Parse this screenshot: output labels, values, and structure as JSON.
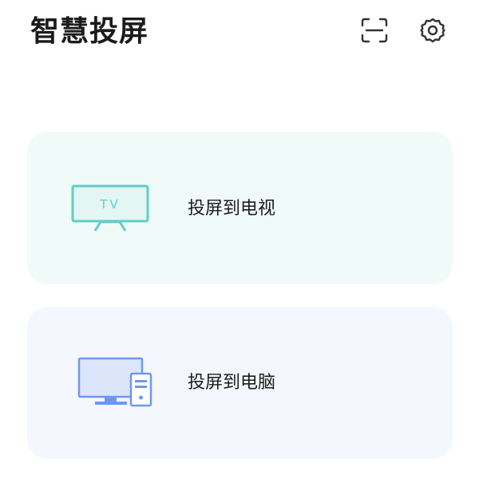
{
  "header": {
    "title": "智慧投屏",
    "scan_icon": "scan-icon",
    "settings_icon": "gear-icon"
  },
  "options": [
    {
      "label": "投屏到电视",
      "icon": "tv-icon",
      "icon_text": "TV",
      "accent": "#5fcfc3",
      "background": "#effaf9"
    },
    {
      "label": "投屏到电脑",
      "icon": "computer-icon",
      "accent": "#6e97ee",
      "background": "#f4f7fd"
    }
  ],
  "colors": {
    "title": "#1b1b1b",
    "icon_stroke": "#333333"
  }
}
